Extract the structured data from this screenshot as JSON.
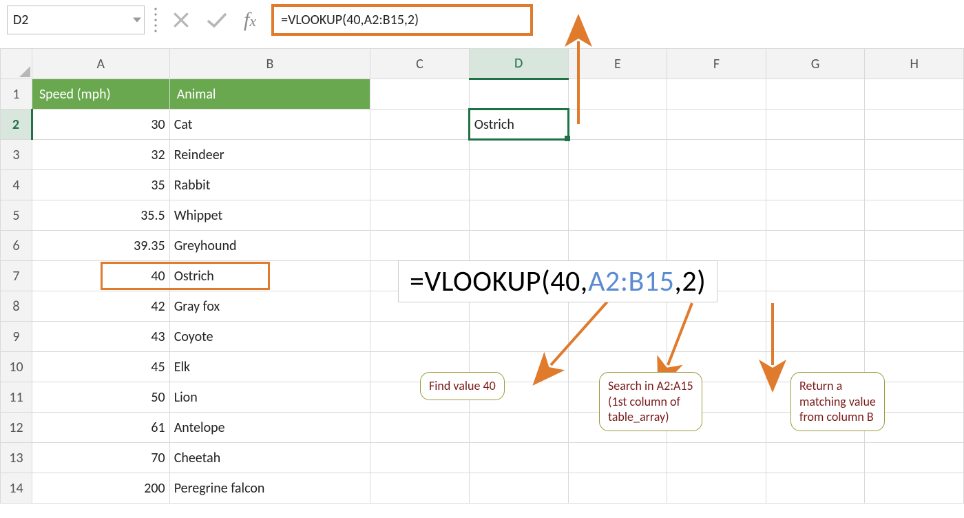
{
  "namebox": {
    "value": "D2"
  },
  "formula_bar": {
    "value": "=VLOOKUP(40,A2:B15,2)"
  },
  "columns": [
    "A",
    "B",
    "C",
    "D",
    "E",
    "F",
    "G",
    "H"
  ],
  "row_numbers": [
    "1",
    "2",
    "3",
    "4",
    "5",
    "6",
    "7",
    "8",
    "9",
    "10",
    "11",
    "12",
    "13",
    "14"
  ],
  "table": {
    "headers": {
      "A": "Speed (mph)",
      "B": "Animal"
    },
    "rows": [
      {
        "speed": "30",
        "animal": "Cat"
      },
      {
        "speed": "32",
        "animal": "Reindeer"
      },
      {
        "speed": "35",
        "animal": "Rabbit"
      },
      {
        "speed": "35.5",
        "animal": "Whippet"
      },
      {
        "speed": "39.35",
        "animal": "Greyhound"
      },
      {
        "speed": "40",
        "animal": "Ostrich"
      },
      {
        "speed": "42",
        "animal": "Gray fox"
      },
      {
        "speed": "43",
        "animal": "Coyote"
      },
      {
        "speed": "45",
        "animal": "Elk"
      },
      {
        "speed": "50",
        "animal": "Lion"
      },
      {
        "speed": "61",
        "animal": "Antelope"
      },
      {
        "speed": "70",
        "animal": "Cheetah"
      },
      {
        "speed": "200",
        "animal": "Peregrine falcon"
      }
    ]
  },
  "d2_value": "Ostrich",
  "big_formula": {
    "p1": "=VLOOKUP(",
    "p2": "40",
    "p3": ",",
    "p4": "A2:B15",
    "p5": ",",
    "p6": "2",
    "p7": ")"
  },
  "callouts": {
    "c1": "Find value 40",
    "c2_l1": "Search in A2:A15",
    "c2_l2": "(1st column of",
    "c2_l3": "table_array)",
    "c3_l1": "Return a",
    "c3_l2": "matching value",
    "c3_l3": "from column B"
  }
}
